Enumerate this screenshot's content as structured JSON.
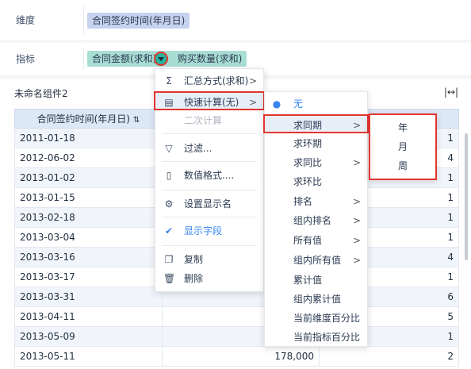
{
  "dimension_row": {
    "label": "维度",
    "field": "合同签约时间(年月日)"
  },
  "indicator_row": {
    "label": "指标",
    "fields": [
      "合同金额(求和)",
      "购买数量(求和)"
    ]
  },
  "widget": {
    "title": "未命名组件2",
    "tool_icon": "fit-width-icon",
    "columns": [
      "合同签约时间(年月日)",
      "",
      ""
    ],
    "rows": [
      [
        "2011-01-18",
        "",
        "1"
      ],
      [
        "2012-06-02",
        "",
        "4"
      ],
      [
        "2013-01-02",
        "",
        "1"
      ],
      [
        "2013-01-15",
        "",
        "1"
      ],
      [
        "2013-02-18",
        "",
        "1"
      ],
      [
        "2013-03-04",
        "",
        "1"
      ],
      [
        "2013-03-16",
        "",
        "4"
      ],
      [
        "2013-03-17",
        "",
        "1"
      ],
      [
        "2013-03-31",
        "",
        "6"
      ],
      [
        "2013-04-11",
        "",
        "5"
      ],
      [
        "2013-05-09",
        "",
        "1"
      ],
      [
        "2013-05-11",
        "178,000",
        "2"
      ]
    ]
  },
  "context_menu": [
    {
      "icon": "sigma-icon",
      "label": "汇总方式(求和)",
      "arrow": ">"
    },
    {
      "icon": "calc-icon",
      "label": "快速计算(无)",
      "arrow": ">"
    },
    {
      "label": "二次计算"
    },
    {
      "icon": "filter-icon",
      "label": "过滤..."
    },
    {
      "icon": "number-format-icon",
      "label": "数值格式...."
    },
    {
      "icon": "gear-icon",
      "label": "设置显示名"
    },
    {
      "icon": "check-icon",
      "label": "显示字段"
    },
    {
      "icon": "copy-icon",
      "label": "复制"
    },
    {
      "icon": "trash-icon",
      "label": "删除"
    }
  ],
  "quick_calc_menu": [
    {
      "label": "无",
      "selected": true
    },
    {
      "label": "求同期",
      "arrow": ">"
    },
    {
      "label": "求环期"
    },
    {
      "label": "求同比",
      "arrow": ">"
    },
    {
      "label": "求环比"
    },
    {
      "label": "排名",
      "arrow": ">"
    },
    {
      "label": "组内排名",
      "arrow": ">"
    },
    {
      "label": "所有值",
      "arrow": ">"
    },
    {
      "label": "组内所有值",
      "arrow": ">"
    },
    {
      "label": "累计值"
    },
    {
      "label": "组内累计值"
    },
    {
      "label": "当前维度百分比"
    },
    {
      "label": "当前指标百分比"
    }
  ],
  "period_menu": [
    {
      "label": "年"
    },
    {
      "label": "月"
    },
    {
      "label": "周"
    }
  ],
  "colors": {
    "accent": "#3685f2",
    "highlight_border": "#e2352f",
    "dim_pill": "#c6d2ee",
    "ind_pill": "#a8ddd3"
  }
}
